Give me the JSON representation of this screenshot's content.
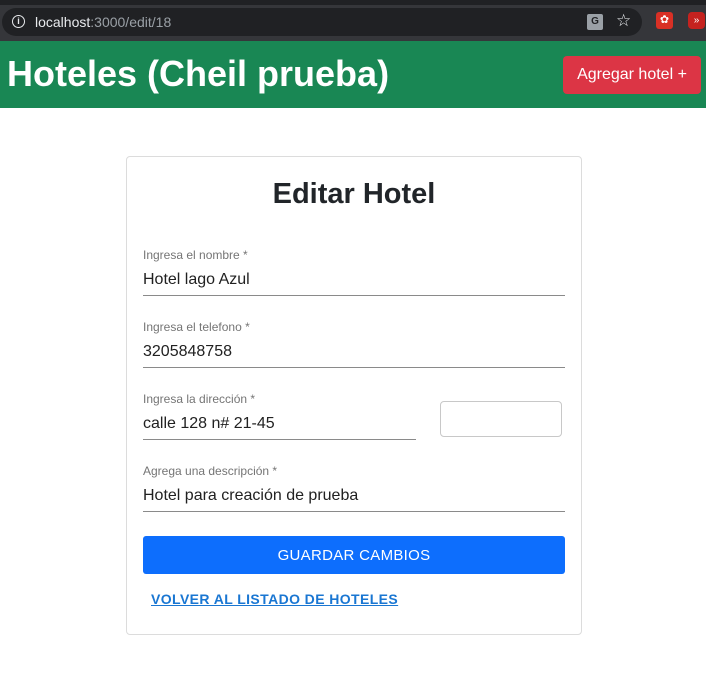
{
  "browser": {
    "url_host": "localhost",
    "url_path": ":3000/edit/18",
    "icons": [
      "info-icon",
      "translate-icon",
      "star-icon",
      "extension-icon",
      "extension-icon"
    ]
  },
  "header": {
    "title": "Hoteles (Cheil prueba)",
    "add_button_label": "Agregar hotel +",
    "colors": {
      "background": "#198754",
      "add_button": "#dc3545"
    }
  },
  "form": {
    "title": "Editar Hotel",
    "fields": {
      "name": {
        "label": "Ingresa el nombre *",
        "value": "Hotel lago Azul"
      },
      "phone": {
        "label": "Ingresa el telefono *",
        "value": "3205848758"
      },
      "address": {
        "label": "Ingresa la dirección *",
        "value": "calle 128 n# 21-45"
      },
      "extra": {
        "value": ""
      },
      "description": {
        "label": "Agrega una descripción *",
        "value": "Hotel para creación de prueba"
      }
    },
    "save_button_label": "GUARDAR CAMBIOS",
    "back_link_label": "VOLVER AL LISTADO DE HOTELES",
    "colors": {
      "save_button": "#0d6efd",
      "link": "#1976d2"
    }
  }
}
